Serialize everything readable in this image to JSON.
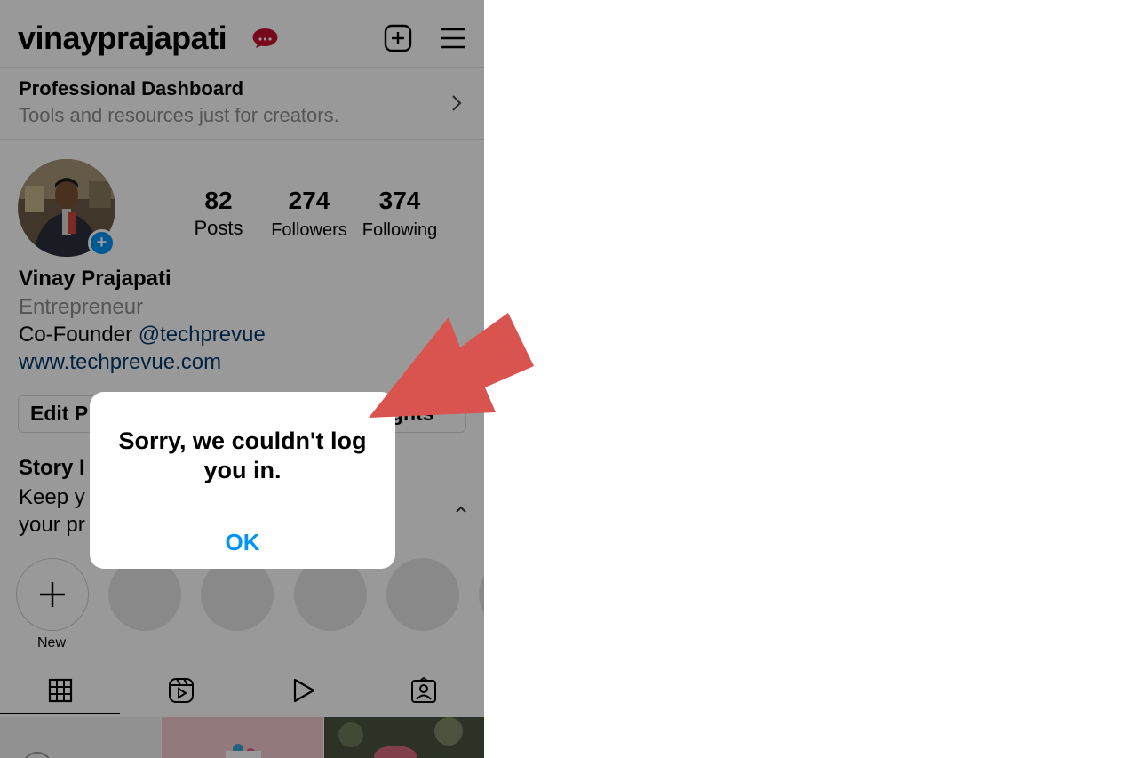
{
  "header": {
    "username": "vinayprajapati",
    "notification_dots": "..."
  },
  "dashboard": {
    "title": "Professional Dashboard",
    "subtitle": "Tools and resources just for creators."
  },
  "profile": {
    "avatar_badge": "+",
    "stats": [
      {
        "value": "82",
        "label": "Posts"
      },
      {
        "value": "274",
        "label": "Followers"
      },
      {
        "value": "374",
        "label": "Following"
      }
    ],
    "name": "Vinay Prajapati",
    "category": "Entrepreneur",
    "bio_prefix": "Co-Founder ",
    "bio_mention": "@techprevue",
    "website": "www.techprevue.com"
  },
  "actions": {
    "edit_profile_visible": "Edit P",
    "insights_visible": "ghts"
  },
  "story_highlights": {
    "title_visible": "Story I",
    "line1_visible": "Keep y",
    "line2_visible": "your pr",
    "new_label": "New"
  },
  "alert": {
    "message": "Sorry, we couldn't log you in.",
    "ok_label": "OK"
  },
  "colors": {
    "accent": "#0095f6",
    "link": "#00376b",
    "annotation_arrow": "#d9534f",
    "notification_badge": "#c8102e"
  },
  "icons": [
    "new-post-icon",
    "menu-icon",
    "chevron-right-icon",
    "chevron-up-icon",
    "plus-icon",
    "grid-icon",
    "reels-icon",
    "video-icon",
    "tagged-icon"
  ]
}
